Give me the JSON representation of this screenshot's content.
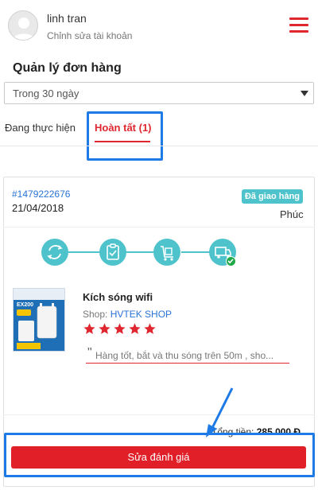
{
  "user": {
    "name": "linh tran",
    "edit_account_label": "Chỉnh sửa tài khoản"
  },
  "page": {
    "title": "Quản lý đơn hàng"
  },
  "filter": {
    "selected": "Trong 30 ngày"
  },
  "tabs": [
    {
      "label": "Đang thực hiện",
      "active": false
    },
    {
      "label": "Hoàn tất (1)",
      "active": true
    }
  ],
  "order": {
    "code": "#1479222676",
    "date": "21/04/2018",
    "status": "Đã giao hàng",
    "receiver": "Phúc",
    "steps": [
      "sync-icon",
      "clipboard-check-icon",
      "cart-box-icon",
      "delivery-truck-icon"
    ],
    "product": {
      "name": "Kích sóng wifi",
      "shop_prefix": "Shop: ",
      "shop_name": "HVTEK SHOP",
      "rating": 5,
      "image_text": "EX200"
    },
    "review_text": "Hàng tốt, bắt và thu sóng trên 50m , sho...",
    "total_label": "Tổng tiền:",
    "total_value": "285.000 Đ"
  },
  "actions": {
    "edit_review_label": "Sửa đánh giá"
  },
  "colors": {
    "accent_red": "#e0262f",
    "teal": "#4fc3cb",
    "link_blue": "#2a73d6",
    "highlight_blue": "#1e7be6"
  }
}
